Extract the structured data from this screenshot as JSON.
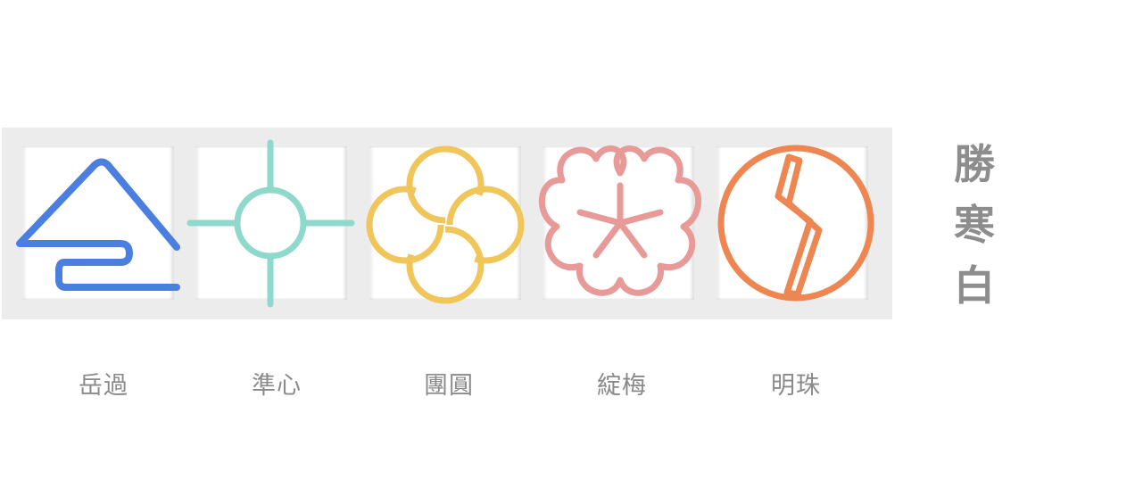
{
  "title": {
    "chars": [
      "勝",
      "寒",
      "白"
    ]
  },
  "emblems": [
    {
      "label": "岳過",
      "icon": "mountain-wave-icon",
      "color": "#4a7fe0"
    },
    {
      "label": "準心",
      "icon": "crosshair-icon",
      "color": "#8fd8cc"
    },
    {
      "label": "團圓",
      "icon": "four-loop-circle-icon",
      "color": "#f0c55a"
    },
    {
      "label": "綻梅",
      "icon": "plum-blossom-icon",
      "color": "#e89a98"
    },
    {
      "label": "明珠",
      "icon": "bolt-circle-icon",
      "color": "#ee8652"
    }
  ],
  "colors": {
    "tray": "#ececec",
    "label_text": "#8a8a8a",
    "title_text": "#8d8d8d"
  }
}
